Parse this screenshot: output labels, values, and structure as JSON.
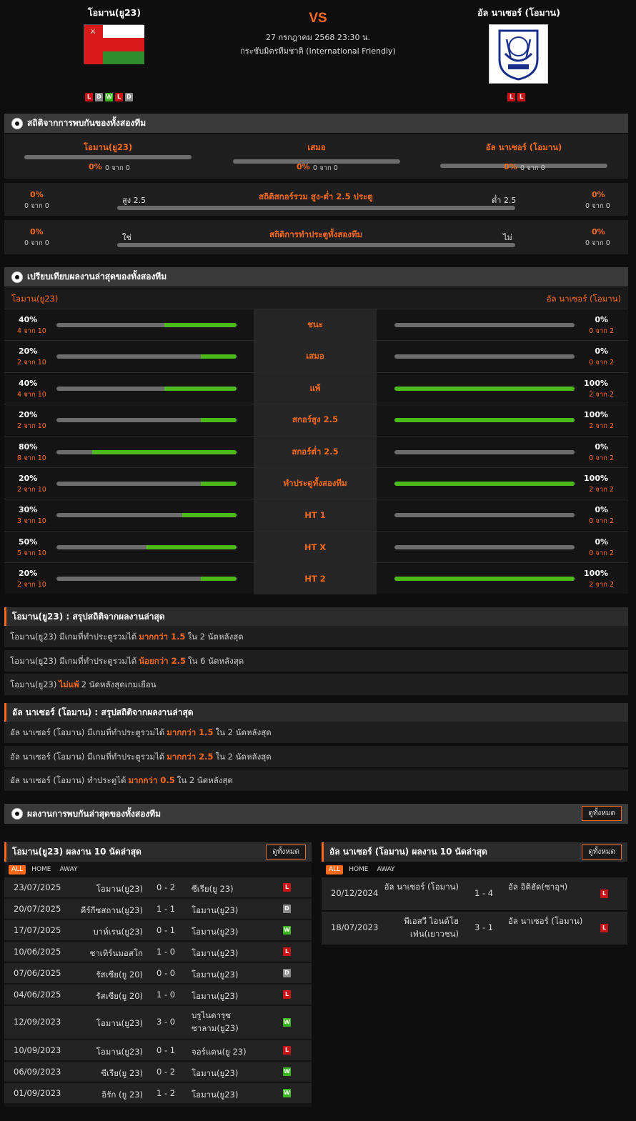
{
  "match": {
    "home": "โอมาน(ยู23)",
    "away": "อัล นาเซอร์ (โอมาน)",
    "vs": "VS",
    "date": "27 กรกฎาคม 2568 23:30 น.",
    "competition": "กระชับมิตรทีมชาติ (International Friendly)",
    "home_form": [
      "L",
      "D",
      "W",
      "L",
      "D"
    ],
    "away_form": [
      "L",
      "L"
    ]
  },
  "h2h": {
    "title": "สถิติจากการพบกันของทั้งสองทีม",
    "cols": [
      {
        "label": "โอมาน(ยู23)",
        "pct": "0%",
        "of": "0 จาก 0"
      },
      {
        "label": "เสมอ",
        "pct": "0%",
        "of": "0 จาก 0"
      },
      {
        "label": "อัล นาเซอร์ (โอมาน)",
        "pct": "0%",
        "of": "0 จาก 0"
      }
    ],
    "ou": {
      "title": "สถิติสกอร์รวม สูง-ต่ำ 2.5 ประตู",
      "left_label": "สูง 2.5",
      "right_label": "ต่ำ 2.5",
      "lpct": "0%",
      "lof": "0 จาก 0",
      "rpct": "0%",
      "rof": "0 จาก 0"
    },
    "btts": {
      "title": "สถิติการทำประตูทั้งสองทีม",
      "left_label": "ใช่",
      "right_label": "ไม่",
      "lpct": "0%",
      "lof": "0 จาก 0",
      "rpct": "0%",
      "rof": "0 จาก 0"
    }
  },
  "compare": {
    "title": "เปรียบเทียบผลงานล่าสุดของทั้งสองทีม",
    "home": "โอมาน(ยู23)",
    "away": "อัล นาเซอร์ (โอมาน)",
    "rows": [
      {
        "label": "ชนะ",
        "lv": "40%",
        "ls": "4 จาก 10",
        "lf": 0.4,
        "rv": "0%",
        "rs": "0 จาก 2",
        "rf": 0
      },
      {
        "label": "เสมอ",
        "lv": "20%",
        "ls": "2 จาก 10",
        "lf": 0.2,
        "rv": "0%",
        "rs": "0 จาก 2",
        "rf": 0
      },
      {
        "label": "แพ้",
        "lv": "40%",
        "ls": "4 จาก 10",
        "lf": 0.4,
        "rv": "100%",
        "rs": "2 จาก 2",
        "rf": 1
      },
      {
        "label": "สกอร์สูง 2.5",
        "lv": "20%",
        "ls": "2 จาก 10",
        "lf": 0.2,
        "rv": "100%",
        "rs": "2 จาก 2",
        "rf": 1
      },
      {
        "label": "สกอร์ต่ำ 2.5",
        "lv": "80%",
        "ls": "8 จาก 10",
        "lf": 0.8,
        "rv": "0%",
        "rs": "0 จาก 2",
        "rf": 0
      },
      {
        "label": "ทำประตูทั้งสองทีม",
        "lv": "20%",
        "ls": "2 จาก 10",
        "lf": 0.2,
        "rv": "100%",
        "rs": "2 จาก 2",
        "rf": 1
      },
      {
        "label": "HT 1",
        "lv": "30%",
        "ls": "3 จาก 10",
        "lf": 0.3,
        "rv": "0%",
        "rs": "0 จาก 2",
        "rf": 0
      },
      {
        "label": "HT X",
        "lv": "50%",
        "ls": "5 จาก 10",
        "lf": 0.5,
        "rv": "0%",
        "rs": "0 จาก 2",
        "rf": 0
      },
      {
        "label": "HT 2",
        "lv": "20%",
        "ls": "2 จาก 10",
        "lf": 0.2,
        "rv": "100%",
        "rs": "2 จาก 2",
        "rf": 1
      }
    ]
  },
  "summary_home": {
    "title": "โอมาน(ยู23) : สรุปสถิติจากผลงานล่าสุด",
    "lines": [
      {
        "a": "โอมาน(ยู23) มีเกมที่ทำประตูรวมได้",
        "b": "มากกว่า 1.5",
        "c": "ใน 2 นัดหลังสุด"
      },
      {
        "a": "โอมาน(ยู23) มีเกมที่ทำประตูรวมได้",
        "b": "น้อยกว่า 2.5",
        "c": "ใน 6 นัดหลังสุด"
      },
      {
        "a": "โอมาน(ยู23)",
        "b": "ไม่แพ้",
        "c": "2 นัดหลังสุดเกมเยือน"
      }
    ]
  },
  "summary_away": {
    "title": "อัล นาเซอร์ (โอมาน) : สรุปสถิติจากผลงานล่าสุด",
    "lines": [
      {
        "a": "อัล นาเซอร์ (โอมาน) มีเกมที่ทำประตูรวมได้",
        "b": "มากกว่า 1.5",
        "c": "ใน 2 นัดหลังสุด"
      },
      {
        "a": "อัล นาเซอร์ (โอมาน) มีเกมที่ทำประตูรวมได้",
        "b": "มากกว่า 2.5",
        "c": "ใน 2 นัดหลังสุด"
      },
      {
        "a": "อัล นาเซอร์ (โอมาน) ทำประตูได้",
        "b": "มากกว่า 0.5",
        "c": "ใน 2 นัดหลังสุด"
      }
    ]
  },
  "recent": {
    "title": "ผลงานการพบกันล่าสุดของทั้งสองทีม",
    "view_all": "ดูทั้งหมด",
    "tabs": [
      "ALL",
      "HOME",
      "AWAY"
    ]
  },
  "home_table": {
    "title": "โอมาน(ยู23) ผลงาน 10 นัดล่าสุด",
    "view_all": "ดูทั้งหมด",
    "rows": [
      {
        "date": "23/07/2025",
        "home": "โอมาน(ยู23)",
        "score": "0 - 2",
        "away": "ซีเรีย(ยู 23)",
        "r": "L"
      },
      {
        "date": "20/07/2025",
        "home": "คีร์กีซสถาน(ยู23)",
        "score": "1 - 1",
        "away": "โอมาน(ยู23)",
        "r": "D"
      },
      {
        "date": "17/07/2025",
        "home": "บาห์เรน(ยู23)",
        "score": "0 - 1",
        "away": "โอมาน(ยู23)",
        "r": "W"
      },
      {
        "date": "10/06/2025",
        "home": "ชาเทิร์นมอสโก",
        "score": "1 - 0",
        "away": "โอมาน(ยู23)",
        "r": "L"
      },
      {
        "date": "07/06/2025",
        "home": "รัสเซีย(ยู 20)",
        "score": "0 - 0",
        "away": "โอมาน(ยู23)",
        "r": "D"
      },
      {
        "date": "04/06/2025",
        "home": "รัสเซีย(ยู 20)",
        "score": "1 - 0",
        "away": "โอมาน(ยู23)",
        "r": "L"
      },
      {
        "date": "12/09/2023",
        "home": "โอมาน(ยู23)",
        "score": "3 - 0",
        "away": "บรูไนดารุซ ซาลาม(ยู23)",
        "r": "W"
      },
      {
        "date": "10/09/2023",
        "home": "โอมาน(ยู23)",
        "score": "0 - 1",
        "away": "จอร์แดน(ยู 23)",
        "r": "L"
      },
      {
        "date": "06/09/2023",
        "home": "ซีเรีย(ยู 23)",
        "score": "0 - 2",
        "away": "โอมาน(ยู23)",
        "r": "W"
      },
      {
        "date": "01/09/2023",
        "home": "อิรัก (ยู 23)",
        "score": "1 - 2",
        "away": "โอมาน(ยู23)",
        "r": "W"
      }
    ]
  },
  "away_table": {
    "title": "อัล นาเซอร์ (โอมาน) ผลงาน 10 นัดล่าสุด",
    "view_all": "ดูทั้งหมด",
    "rows": [
      {
        "date": "20/12/2024",
        "home": "อัล นาเซอร์ (โอมาน)",
        "score": "1 - 4",
        "away": "อัล อิติฮัด(ซาอุฯ)",
        "r": "L"
      },
      {
        "date": "18/07/2023",
        "home": "พีเอสวี ไอนด์โฮ เฟ่น(เยาวชน)",
        "score": "3 - 1",
        "away": "อัล นาเซอร์ (โอมาน)",
        "r": "L"
      }
    ]
  },
  "colors": {
    "accent": "#ff6a1a",
    "win": "#3ab51a",
    "loss": "#c81414",
    "draw": "#8a8a8a",
    "bar_fill": "#4cbb17"
  }
}
